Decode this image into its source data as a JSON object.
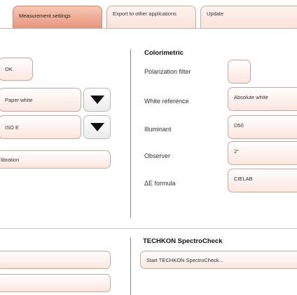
{
  "tabs": [
    {
      "label": "Measurement settings"
    },
    {
      "label": "Export to other applications"
    },
    {
      "label": "Update"
    }
  ],
  "left": {
    "ok_label": "OK",
    "paper_select_value": "Paper white",
    "standard_select_value": "ISO E",
    "calibration_label": "libration"
  },
  "colorimetric": {
    "heading": "Colorimetric",
    "polarization_label": "Polarization filter",
    "white_reference_label": "White reference",
    "white_reference_value": "Absolute white",
    "illuminant_label": "Illuminant",
    "illuminant_value": "D50",
    "observer_label": "Observer",
    "observer_value": "2°",
    "delta_e_label": "ΔE formula",
    "delta_e_value": "CIELAB"
  },
  "spectrocheck": {
    "heading": "TECHKON SpectroCheck",
    "start_label": "Start TECHKON SpectroCheck..."
  }
}
